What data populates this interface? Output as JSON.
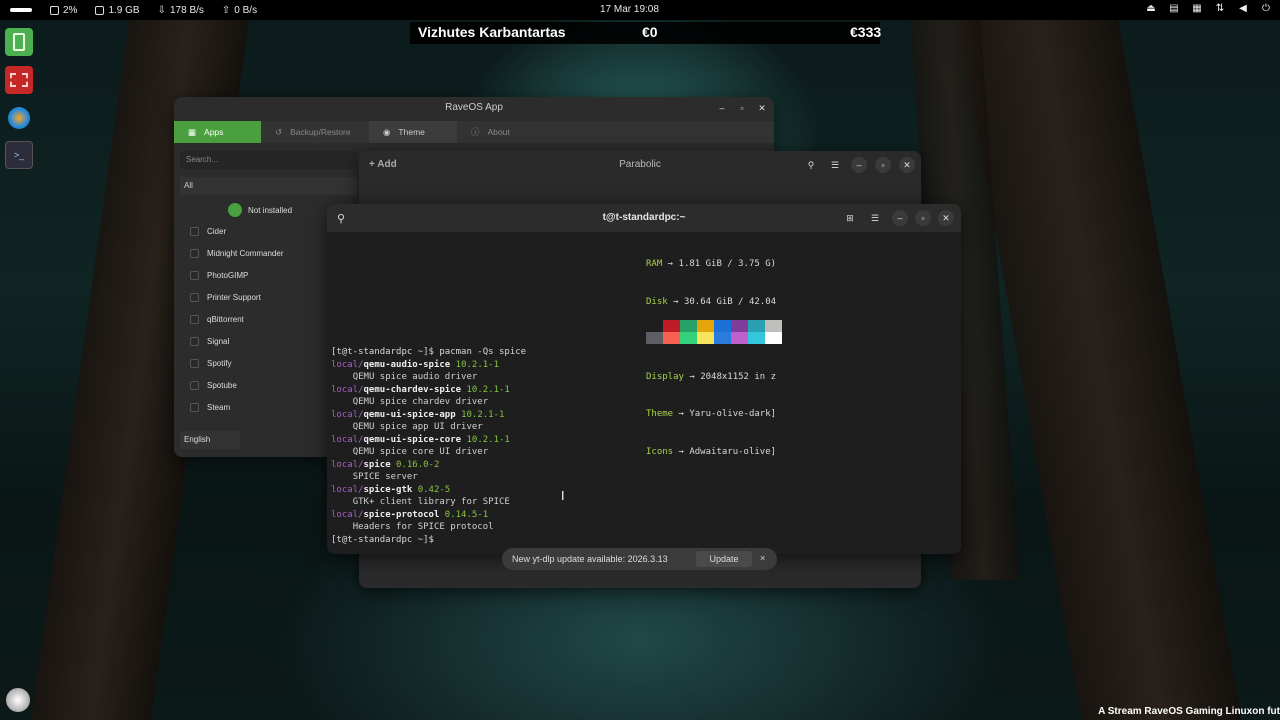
{
  "topbar": {
    "cpu": "2%",
    "memory": "1.9 GB",
    "download": "178 B/s",
    "upload": "0 B/s",
    "clock": "17 Mar  19:08"
  },
  "widget": {
    "name": "Vizhutes Karbantartas",
    "value1": "€0",
    "value2": "€333"
  },
  "raveos": {
    "title": "RaveOS App",
    "tabs": [
      "Apps",
      "Backup/Restore",
      "Theme",
      "About"
    ],
    "search_placeholder": "Search...",
    "category": "All",
    "filter": "Not installed",
    "apps": [
      "Cider",
      "Midnight Commander",
      "PhotoGIMP",
      "Printer Support",
      "qBittorrent",
      "Signal",
      "Spotify",
      "Spotube",
      "Steam"
    ],
    "language": "English"
  },
  "parabolic": {
    "title": "Parabolic",
    "add_label": "Add"
  },
  "terminal": {
    "title": "t@t-standardpc:~",
    "fastfetch": [
      {
        "key": "RAM",
        "value": " → 1.81 GiB / 3.75 G)"
      },
      {
        "key": "Disk",
        "value": " → 30.64 GiB / 42.04"
      },
      {
        "key": "",
        "value": "--------------"
      },
      {
        "key": "Display",
        "value": " → 2048x1152 in z"
      },
      {
        "key": "Theme",
        "value": " → Yaru-olive-dark]"
      },
      {
        "key": "Icons",
        "value": " → Adwaitaru-olive]"
      }
    ],
    "swatch_colors_top": [
      "#1e1e1e",
      "#c01c28",
      "#26a269",
      "#e5a50a",
      "#1c71d8",
      "#813d9c",
      "#2aa1b3",
      "#c0bfbc"
    ],
    "swatch_colors_bottom": [
      "#5e5c64",
      "#f66151",
      "#33d17a",
      "#f8e45c",
      "#2a7bde",
      "#c061cb",
      "#33c7de",
      "#ffffff"
    ],
    "prompt": "[t@t-standardpc ~]$ ",
    "command": "pacman -Qs spice",
    "packages": [
      {
        "repo": "local/",
        "name": "qemu-audio-spice",
        "version": "10.2.1-1",
        "desc": "QEMU spice audio driver"
      },
      {
        "repo": "local/",
        "name": "qemu-chardev-spice",
        "version": "10.2.1-1",
        "desc": "QEMU spice chardev driver"
      },
      {
        "repo": "local/",
        "name": "qemu-ui-spice-app",
        "version": "10.2.1-1",
        "desc": "QEMU spice app UI driver"
      },
      {
        "repo": "local/",
        "name": "qemu-ui-spice-core",
        "version": "10.2.1-1",
        "desc": "QEMU spice core UI driver"
      },
      {
        "repo": "local/",
        "name": "spice",
        "version": "0.16.0-2",
        "desc": "SPICE server"
      },
      {
        "repo": "local/",
        "name": "spice-gtk",
        "version": "0.42-5",
        "desc": "GTK+ client library for SPICE"
      },
      {
        "repo": "local/",
        "name": "spice-protocol",
        "version": "0.14.5-1",
        "desc": "Headers for SPICE protocol"
      }
    ],
    "final_prompt": "[t@t-standardpc ~]$"
  },
  "notification": {
    "message": "New yt-dlp update available: 2026.3.13",
    "button": "Update",
    "close": "×"
  },
  "caption": "A Stream RaveOS Gaming Linuxon fut"
}
